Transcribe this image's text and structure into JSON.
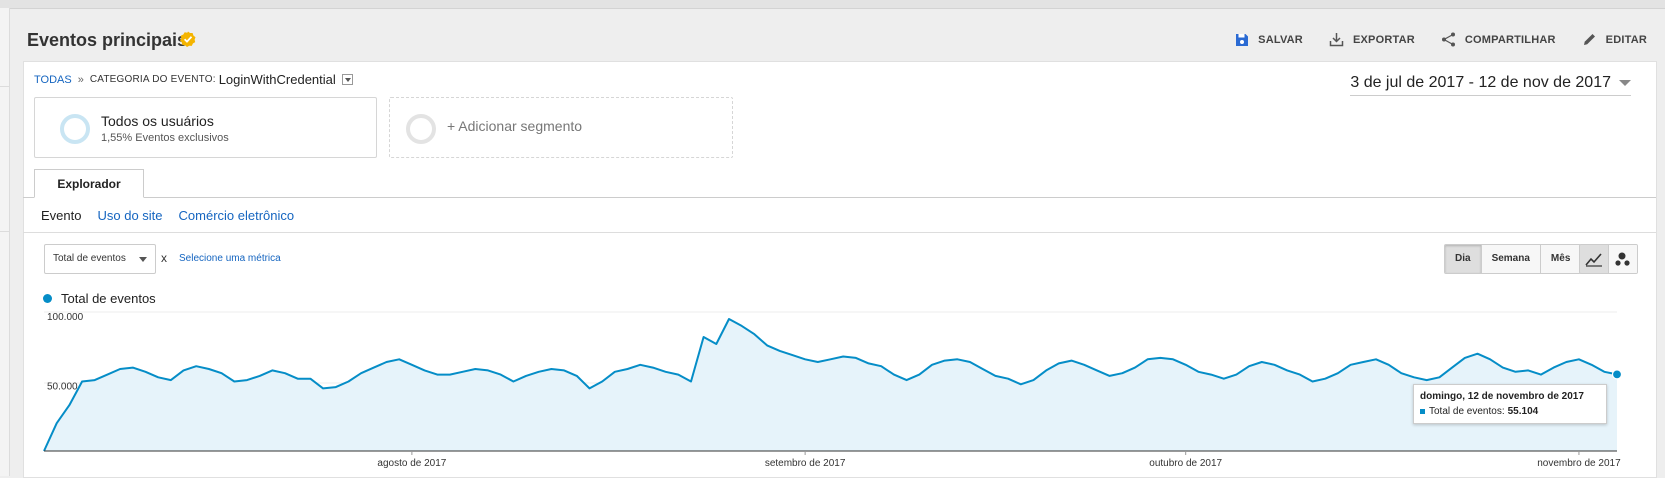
{
  "header": {
    "title": "Eventos principais",
    "actions": {
      "save": "SALVAR",
      "export": "EXPORTAR",
      "share": "COMPARTILHAR",
      "edit": "EDITAR"
    }
  },
  "breadcrumb": {
    "all": "TODAS",
    "separator": "»",
    "category_label": "CATEGORIA DO EVENTO:",
    "category_value": "LoginWithCredential"
  },
  "date_range": "3 de jul de 2017 - 12 de nov de 2017",
  "segments": {
    "primary_name": "Todos os usuários",
    "primary_sub": "1,55% Eventos exclusivos",
    "add": "+ Adicionar segmento"
  },
  "tabs": {
    "explorer": "Explorador",
    "subtabs": [
      "Evento",
      "Uso do site",
      "Comércio eletrônico"
    ]
  },
  "controls": {
    "metric": "Total de eventos",
    "vs": "x",
    "select_metric": "Selecione uma métrica",
    "periods": [
      "Dia",
      "Semana",
      "Mês"
    ],
    "active_period": "Dia"
  },
  "legend": {
    "series": "Total de eventos"
  },
  "tooltip": {
    "title": "domingo, 12 de novembro de 2017",
    "label": "Total de eventos:",
    "value": "55.104"
  },
  "colors": {
    "line": "#058dc7",
    "fill": "#e6f3fa",
    "accent": "#1565c0"
  },
  "chart_data": {
    "type": "area",
    "x_start": "2017-07-03",
    "x_end": "2017-11-12",
    "y_ticks": [
      "100.000",
      "50.000"
    ],
    "ylim": [
      0,
      100000
    ],
    "x_tick_labels": [
      "agosto de 2017",
      "setembro de 2017",
      "outubro de 2017",
      "novembro de 2017"
    ],
    "series": [
      {
        "name": "Total de eventos",
        "values": [
          0,
          20000,
          33000,
          50000,
          51000,
          55000,
          59000,
          60000,
          57000,
          53000,
          51000,
          58000,
          61000,
          59000,
          56000,
          50000,
          51000,
          54000,
          58000,
          56000,
          52000,
          52000,
          45000,
          46000,
          50000,
          56000,
          60000,
          64000,
          66000,
          62000,
          58000,
          55000,
          55000,
          57000,
          59000,
          58000,
          55000,
          50000,
          54000,
          57000,
          59000,
          58000,
          54000,
          45000,
          50000,
          57000,
          59000,
          62000,
          60000,
          57000,
          55000,
          50000,
          82000,
          77000,
          95000,
          90000,
          84000,
          76000,
          72000,
          69000,
          66000,
          64000,
          66000,
          68000,
          67000,
          63000,
          61000,
          55000,
          51000,
          55000,
          62000,
          65000,
          66000,
          64000,
          59000,
          54000,
          52000,
          48000,
          51000,
          58000,
          63000,
          65000,
          62000,
          58000,
          54000,
          56000,
          60000,
          66000,
          67000,
          66000,
          62000,
          57000,
          55000,
          52000,
          55000,
          61000,
          64000,
          62000,
          58000,
          55000,
          50000,
          52000,
          56000,
          62000,
          64000,
          66000,
          62000,
          56000,
          53000,
          51000,
          53000,
          60000,
          67000,
          70000,
          66000,
          60000,
          57000,
          58000,
          55000,
          60000,
          64000,
          66000,
          62000,
          57000,
          55104
        ]
      }
    ]
  }
}
